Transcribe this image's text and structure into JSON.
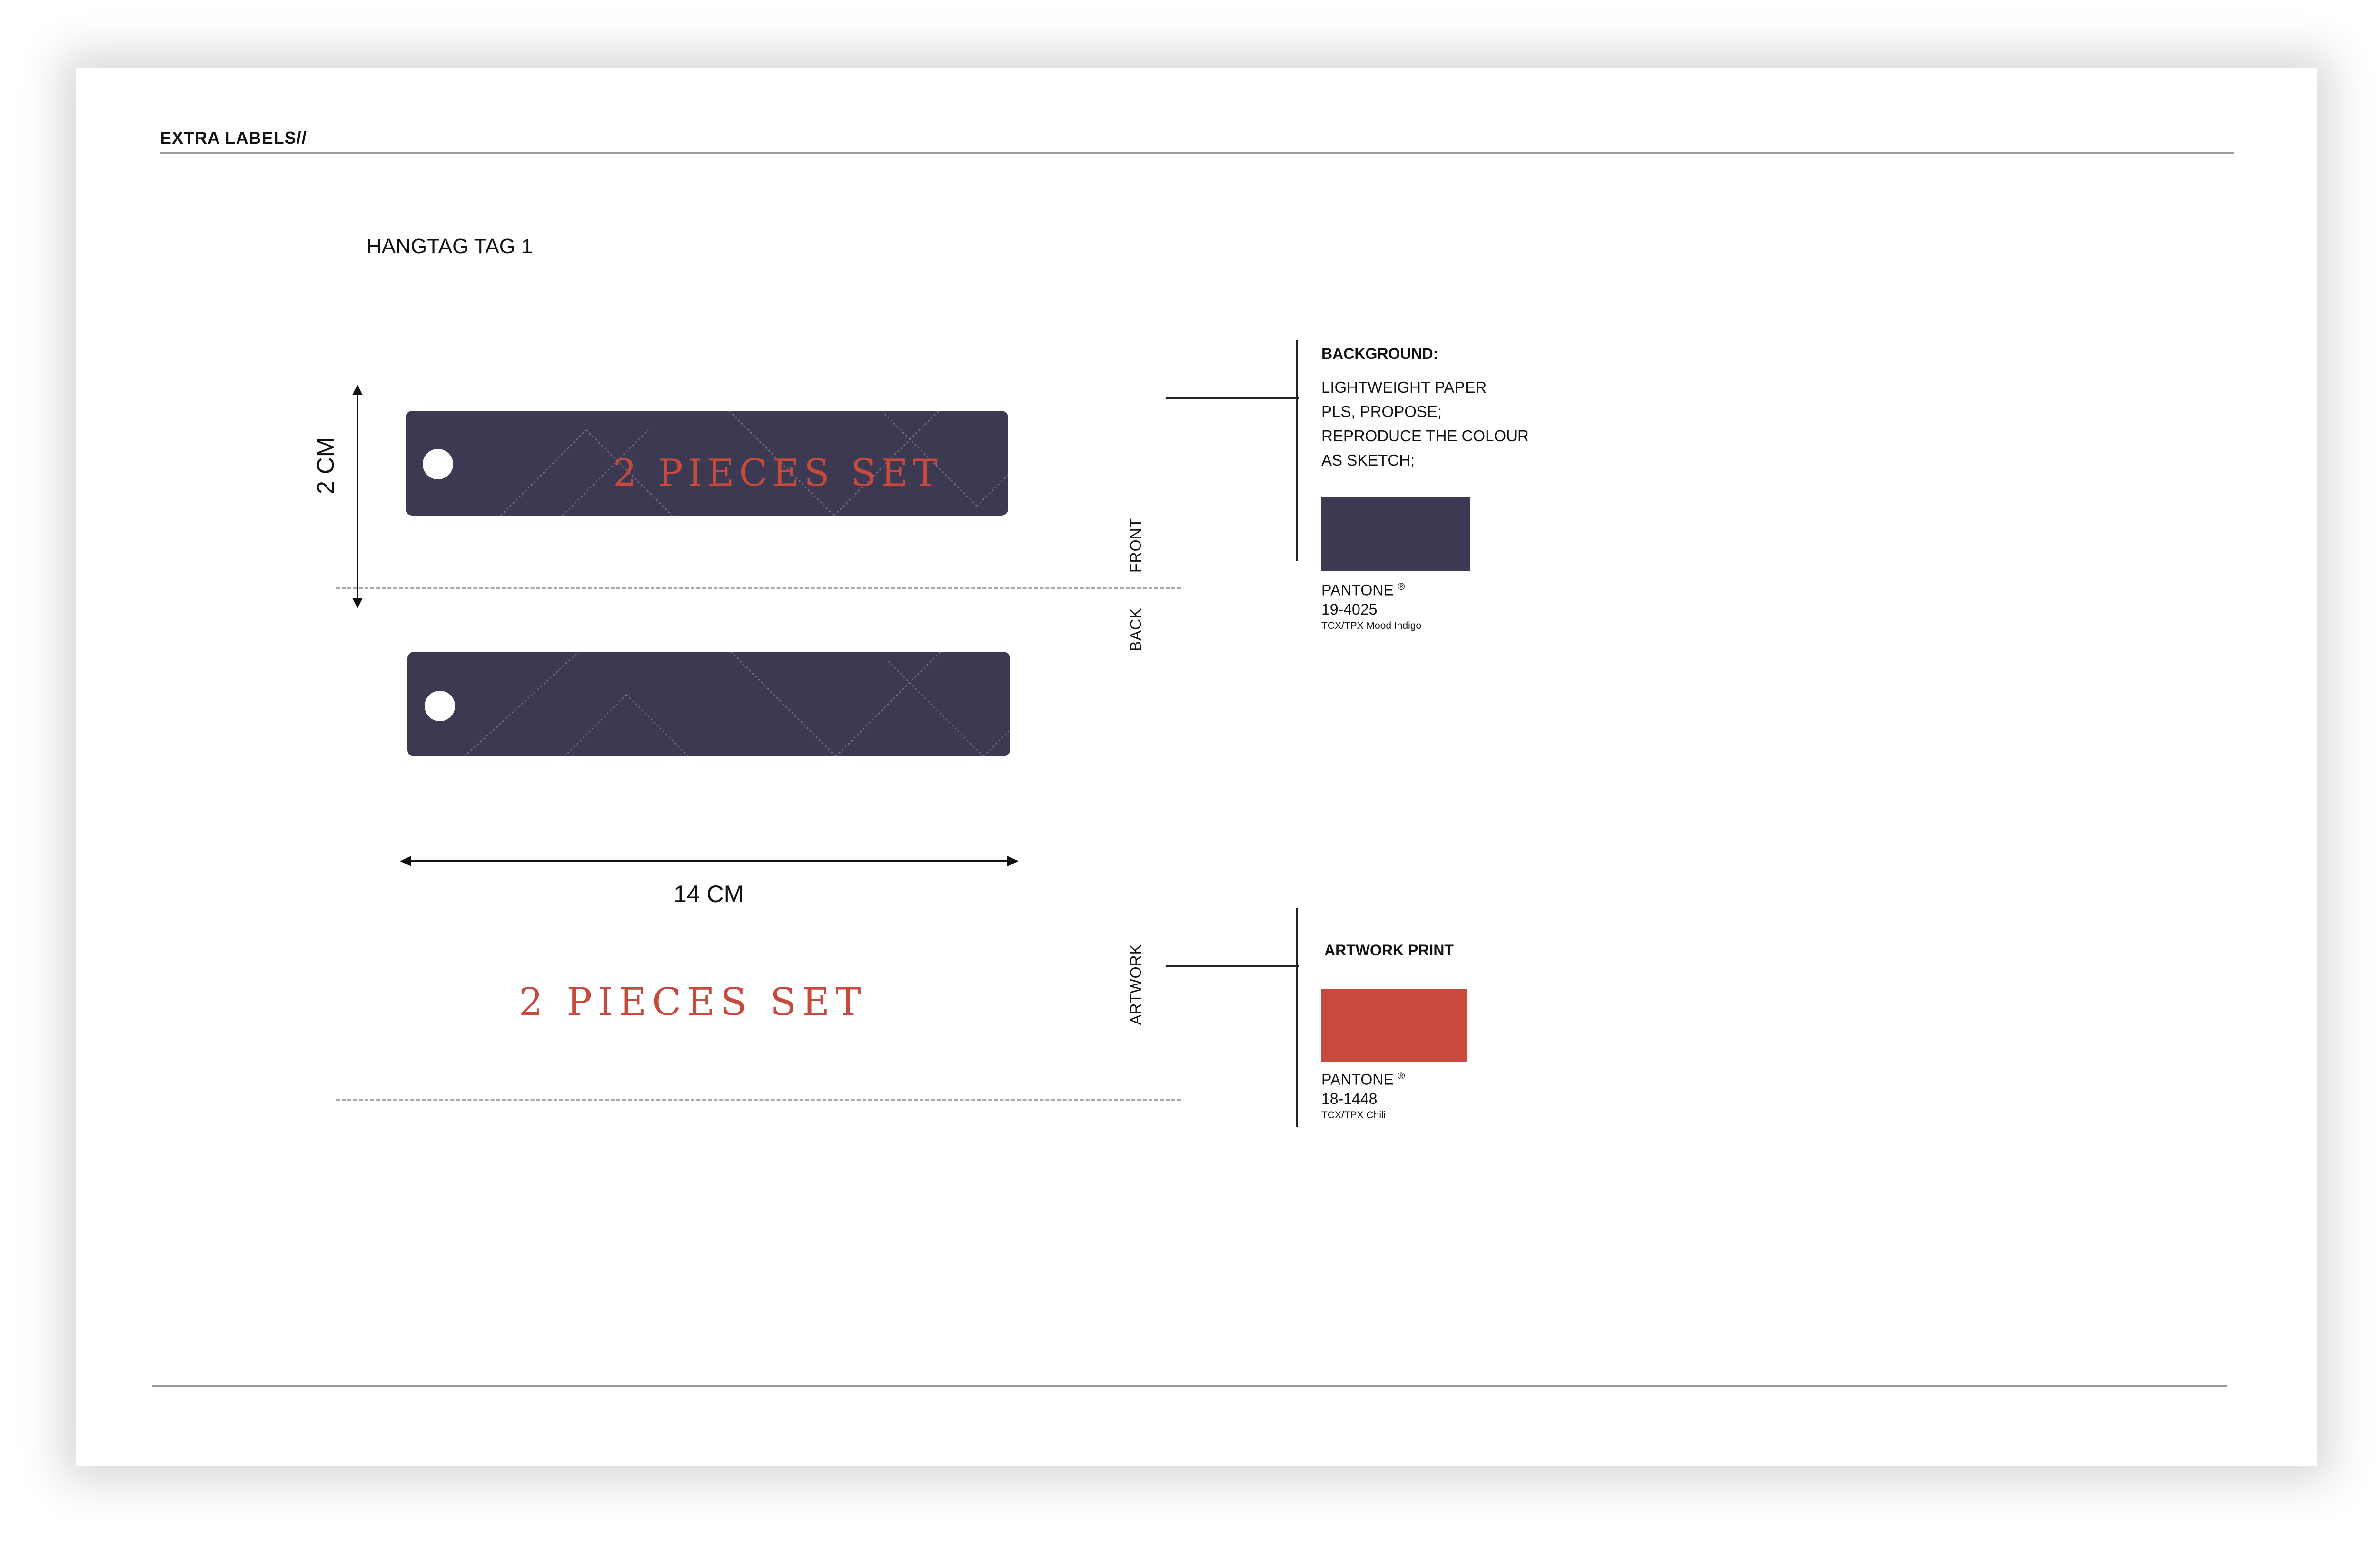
{
  "page_title": "EXTRA LABELS//",
  "section_title": "HANGTAG TAG 1",
  "tag": {
    "front_text": "2 PIECES SET",
    "height_label": "2 CM",
    "width_label": "14 CM",
    "background_color": "#3b3a52",
    "text_color": "#c84a3c"
  },
  "side_labels": {
    "front": "FRONT",
    "back": "BACK",
    "artwork": "ARTWORK"
  },
  "artwork_text": "2 PIECES SET",
  "background_spec": {
    "heading": "BACKGROUND:",
    "lines": [
      "LIGHTWEIGHT PAPER",
      "PLS, PROPOSE;",
      "REPRODUCE THE COLOUR",
      "AS SKETCH;"
    ],
    "swatch_color": "#3b3a52",
    "pantone_label": "PANTONE",
    "registered": "®",
    "pantone_code": "19-4025",
    "pantone_name": "TCX/TPX Mood Indigo"
  },
  "artwork_spec": {
    "heading": "ARTWORK PRINT",
    "swatch_color": "#c84a3c",
    "pantone_label": "PANTONE",
    "registered": "®",
    "pantone_code": "18-1448",
    "pantone_name": "TCX/TPX Chili"
  }
}
